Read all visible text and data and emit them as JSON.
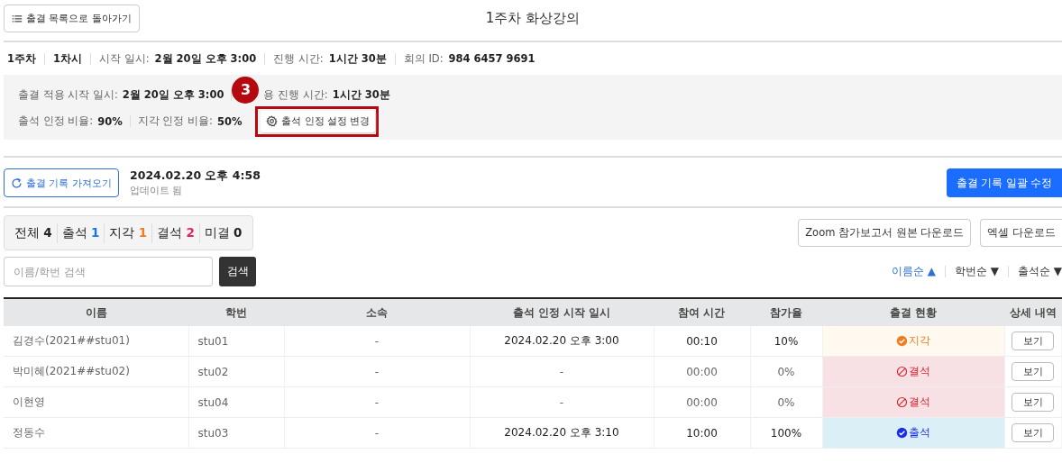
{
  "back_button": {
    "label": "출결 목록으로 돌아가기"
  },
  "title": "1주차 화상강의",
  "meeting_info": [
    {
      "kind": "plain",
      "text": "1주차"
    },
    {
      "kind": "plain",
      "text": "1차시"
    },
    {
      "kind": "pair",
      "label": "시작 일시:",
      "value": "2월 20일 오후 3:00"
    },
    {
      "kind": "pair",
      "label": "진행 시간:",
      "value": "1시간 30분"
    },
    {
      "kind": "pair",
      "label": "회의 ID:",
      "value": "984 6457 9691"
    }
  ],
  "settings": {
    "application_line": {
      "items": [
        {
          "label": "출결 적용 시작 일시:",
          "value": "2월 20일 오후 3:00"
        },
        {
          "label": "용 진행 시간:",
          "value": "1시간 30분",
          "badge": "3"
        }
      ]
    },
    "ratio_line": {
      "items": [
        {
          "label": "출석 인정 비율:",
          "value": "90%"
        },
        {
          "label": "지각 인정 비율:",
          "value": "50%"
        }
      ]
    },
    "change_button": {
      "label": "출석 인정 설정 변경",
      "highlighted": true
    }
  },
  "sync": {
    "button": "출결 기록 가져오기",
    "time": "2024.02.20 오후 4:58",
    "note": "업데이트 됨",
    "bulk_button": "출결 기록 일괄 수정"
  },
  "filters": [
    {
      "label": "전체",
      "count": "4",
      "color": "#222222"
    },
    {
      "label": "출석",
      "count": "1",
      "color": "#1a73e8"
    },
    {
      "label": "지각",
      "count": "1",
      "color": "#f07c1e"
    },
    {
      "label": "결석",
      "count": "2",
      "color": "#e0245e"
    },
    {
      "label": "미결",
      "count": "0",
      "color": "#222222"
    }
  ],
  "downloads": [
    "Zoom 참가보고서 원본 다운로드",
    "엑셀 다운로드"
  ],
  "search": {
    "placeholder": "이름/학번 검색",
    "button": "검색"
  },
  "sort_options": [
    {
      "label": "이름순",
      "arrow": "▲",
      "selected": true
    },
    {
      "label": "학번순",
      "arrow": "▼",
      "selected": false
    },
    {
      "label": "출석순",
      "arrow": "▼",
      "selected": false
    }
  ],
  "table": {
    "columns": [
      "이름",
      "학번",
      "소속",
      "출석 인정 시작 일시",
      "참여 시간",
      "참가율",
      "출결 현황",
      "상세 내역"
    ],
    "rows": [
      {
        "name": "김경수(2021##stu01)",
        "id": "stu01",
        "affiliation": "-",
        "start": "2024.02.20 오후 3:00",
        "duration": "00:10",
        "rate": "10%",
        "status": {
          "kind": "late",
          "label": "지각"
        },
        "detail": "보기"
      },
      {
        "name": "박미혜(2021##stu02)",
        "id": "stu02",
        "affiliation": "-",
        "start": "-",
        "duration": "00:00",
        "rate": "0%",
        "status": {
          "kind": "absent",
          "label": "결석"
        },
        "detail": "보기"
      },
      {
        "name": "이현영",
        "id": "stu04",
        "affiliation": "-",
        "start": "-",
        "duration": "00:00",
        "rate": "0%",
        "status": {
          "kind": "absent",
          "label": "결석"
        },
        "detail": "보기"
      },
      {
        "name": "정동수",
        "id": "stu03",
        "affiliation": "-",
        "start": "2024.02.20 오후 3:10",
        "duration": "10:00",
        "rate": "100%",
        "status": {
          "kind": "present",
          "label": "출석"
        },
        "detail": "보기"
      }
    ]
  }
}
